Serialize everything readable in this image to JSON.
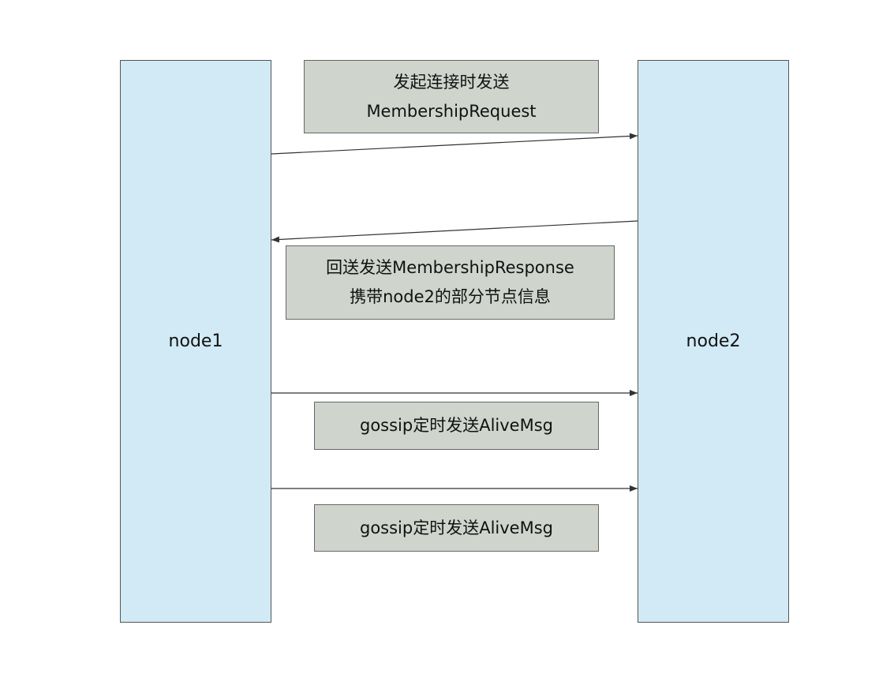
{
  "nodes": {
    "left": "node1",
    "right": "node2"
  },
  "messages": [
    {
      "lines": [
        "发起连接时发送",
        "MembershipRequest"
      ],
      "direction": "node1-to-node2"
    },
    {
      "lines": [
        "回送发送MembershipResponse",
        "携带node2的部分节点信息"
      ],
      "direction": "node2-to-node1"
    },
    {
      "lines": [
        "gossip定时发送AliveMsg"
      ],
      "direction": "node1-to-node2"
    },
    {
      "lines": [
        "gossip定时发送AliveMsg"
      ],
      "direction": "node1-to-node2"
    }
  ],
  "colors": {
    "node_fill": "#d1eaf5",
    "note_fill": "#cfd5cd",
    "line": "#333333"
  }
}
